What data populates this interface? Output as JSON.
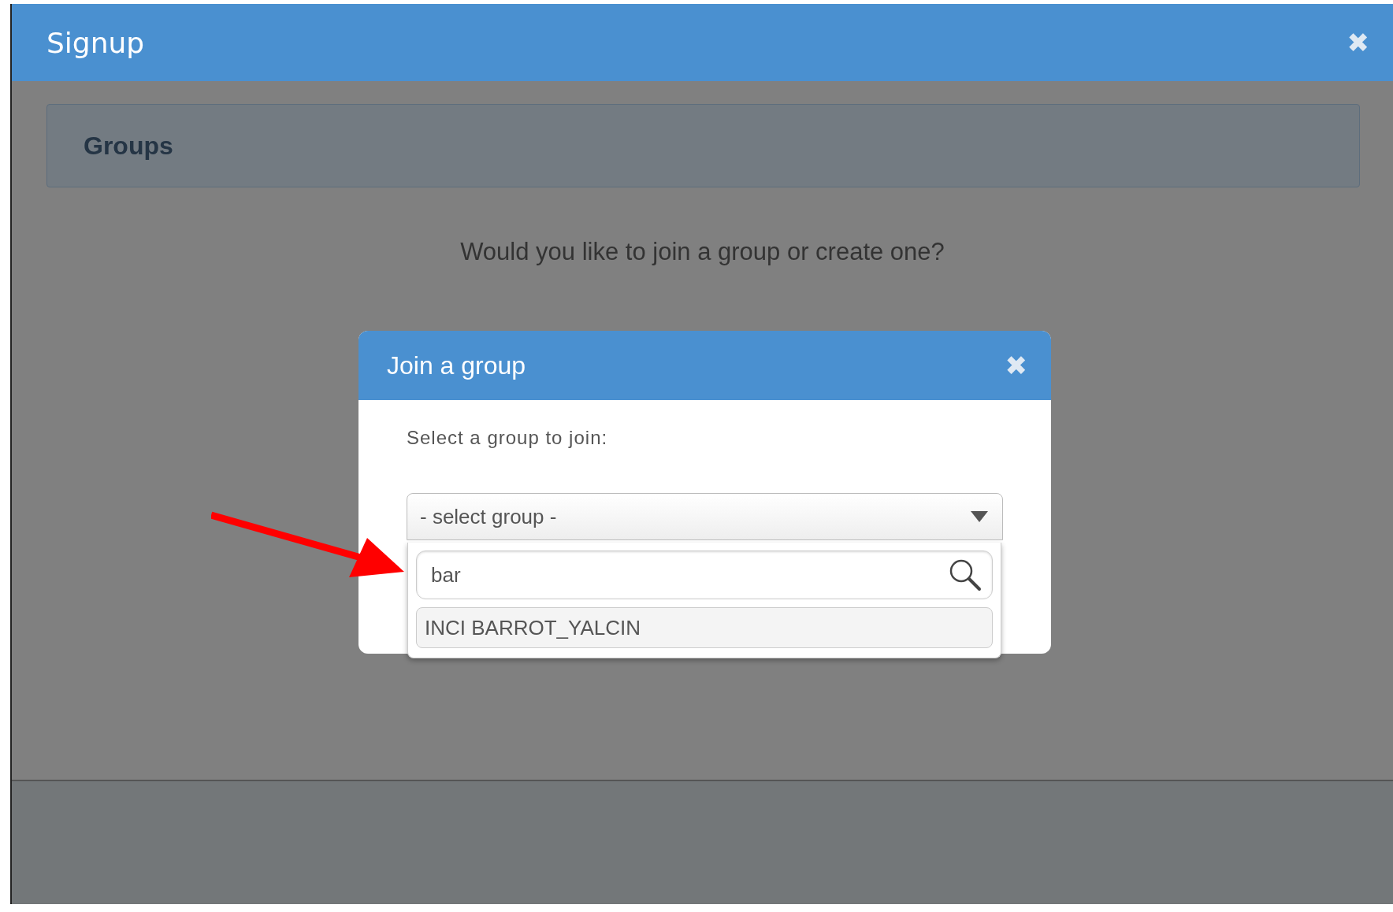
{
  "window": {
    "title": "Signup",
    "close_icon": "✖"
  },
  "panel": {
    "title": "Groups"
  },
  "prompt": "Would you like to join a group or create one?",
  "dialog": {
    "title": "Join a group",
    "close_icon": "✖",
    "label": "Select a group to join:",
    "select": {
      "value": "- select group -",
      "expanded": true
    },
    "search": {
      "value": "bar"
    },
    "options": [
      {
        "label": "INCI BARROT_YALCIN",
        "selected": false
      }
    ]
  }
}
